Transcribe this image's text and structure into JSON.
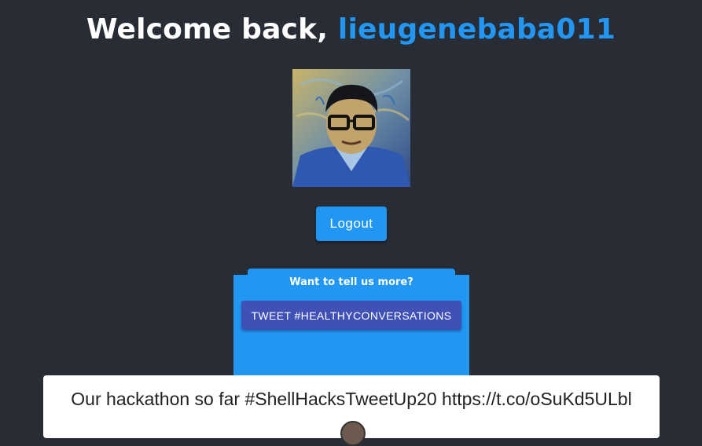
{
  "header": {
    "greeting": "Welcome back, ",
    "username": "lieugenebaba011"
  },
  "profile": {
    "avatar_icon": "user-portrait-painting"
  },
  "actions": {
    "logout_label": "Logout"
  },
  "prompt_card": {
    "title": "Want to tell us more?",
    "tweet_button_label": "TWEET #HEALTHYCONVERSATIONS"
  },
  "tweet": {
    "text": "Our hackathon so far #ShellHacksTweetUp20 https://t.co/oSuKd5ULbl"
  },
  "colors": {
    "background": "#282c34",
    "accent": "#2196f3",
    "tweet_button": "#3f51b5"
  }
}
